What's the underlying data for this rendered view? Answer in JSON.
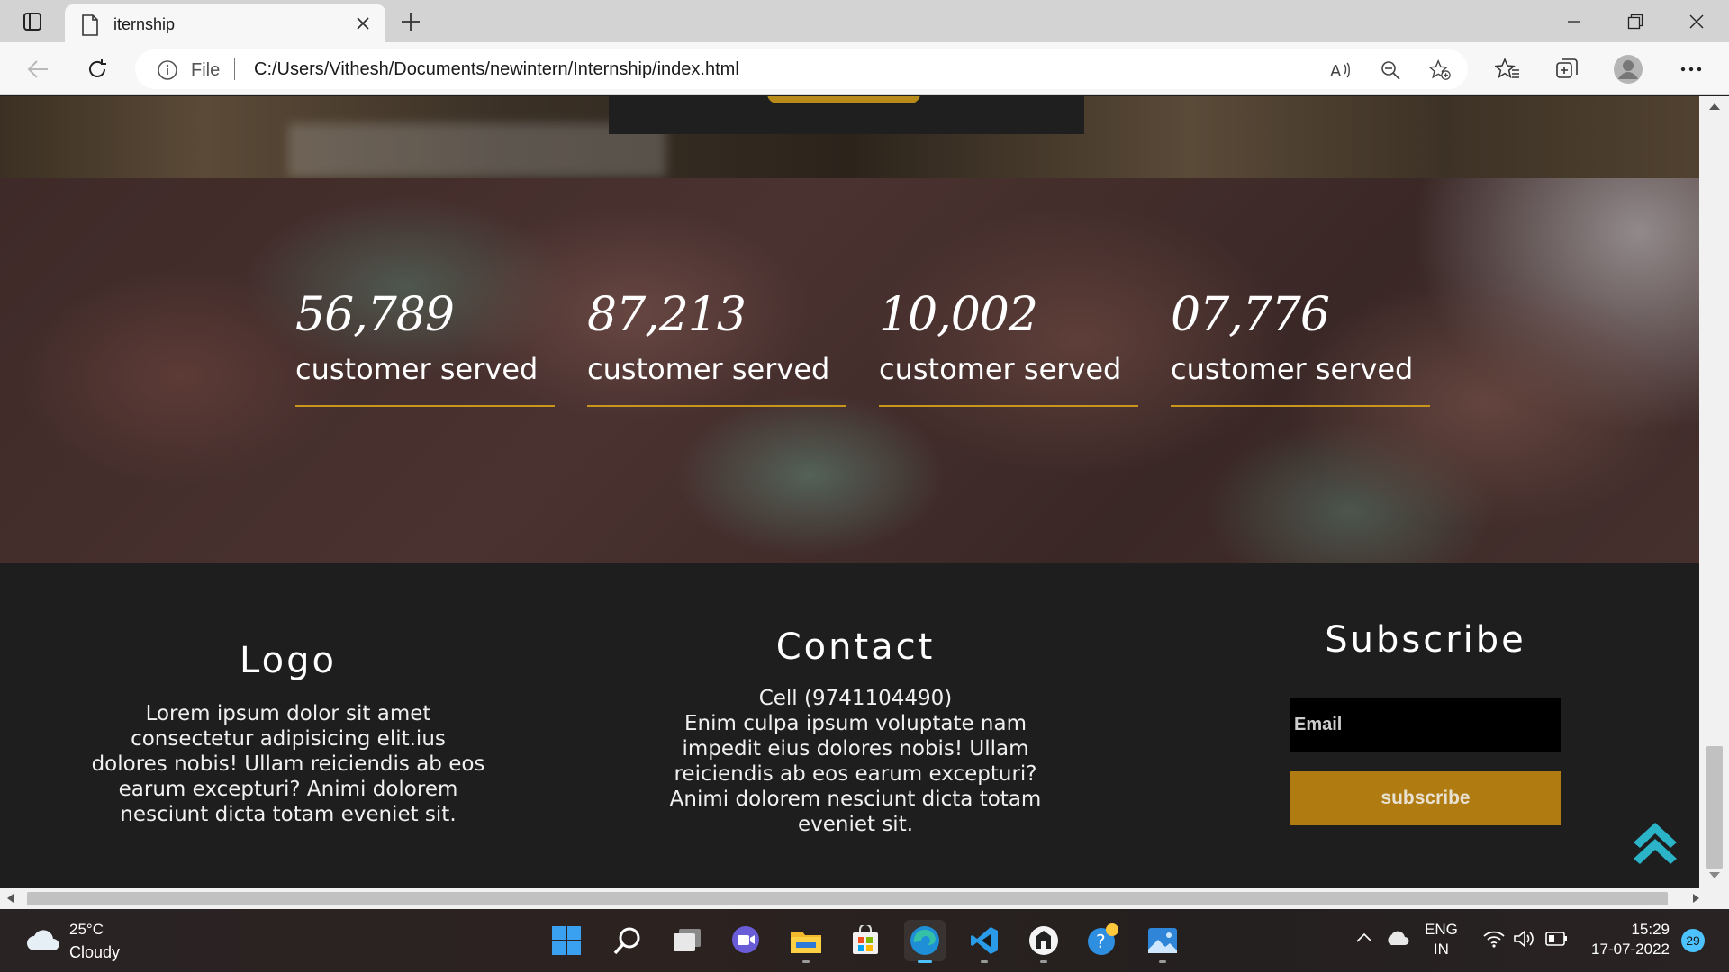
{
  "browser": {
    "tab_title": "iternship",
    "address_scheme": "File",
    "url": "C:/Users/Vithesh/Documents/newintern/Internship/index.html"
  },
  "stats": [
    {
      "number": "56,789",
      "label": "customer served"
    },
    {
      "number": "87,213",
      "label": "customer served"
    },
    {
      "number": "10,002",
      "label": "customer served"
    },
    {
      "number": "07,776",
      "label": "customer served"
    }
  ],
  "footer": {
    "logo": {
      "heading": "Logo",
      "text": "Lorem ipsum dolor sit amet consectetur adipisicing elit.ius dolores nobis! Ullam reiciendis ab eos earum excepturi? Animi dolorem nesciunt dicta totam eveniet sit."
    },
    "contact": {
      "heading": "Contact",
      "phone": "Cell (9741104490)",
      "text": "Enim culpa ipsum voluptate nam impedit eius dolores nobis! Ullam reiciendis ab eos earum excepturi? Animi dolorem nesciunt dicta totam eveniet sit."
    },
    "subscribe": {
      "heading": "Subscribe",
      "email_placeholder": "Email",
      "button_label": "subscribe"
    }
  },
  "taskbar": {
    "weather_temp": "25°C",
    "weather_condition": "Cloudy",
    "language": "ENG",
    "region": "IN",
    "time": "15:29",
    "date": "17-07-2022",
    "notification_count": "29"
  },
  "colors": {
    "accent_gold": "#b07c12",
    "stat_underline": "#c8961c",
    "footer_bg": "#1e1e1e",
    "scroll_top_icon": "#2bb3c8"
  }
}
